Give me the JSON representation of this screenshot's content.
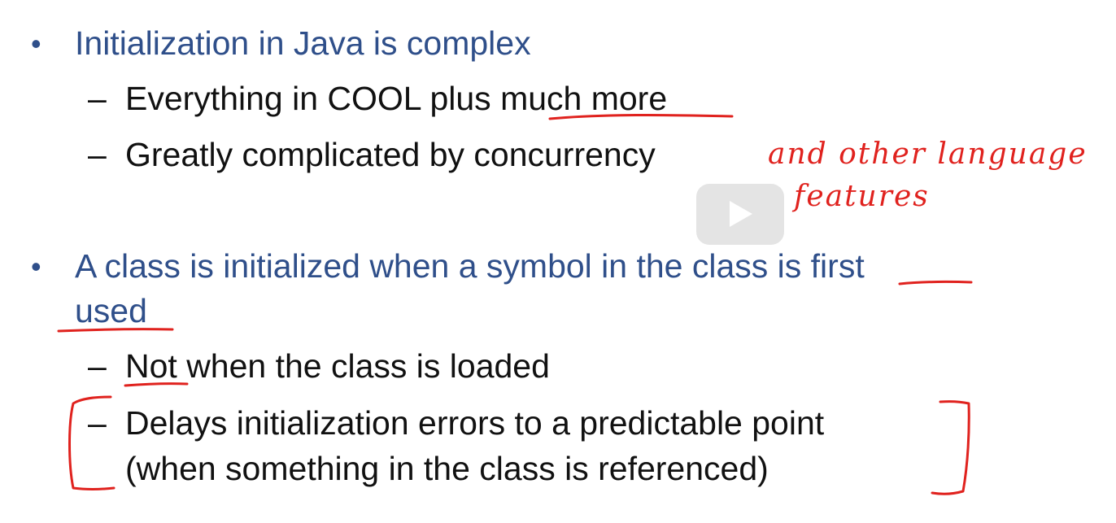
{
  "slide": {
    "bullets": [
      {
        "text": "Initialization in Java is complex",
        "sub": [
          "Everything in COOL plus much more",
          "Greatly complicated by concurrency"
        ]
      },
      {
        "text_line1": "A class is initialized when a symbol in the class is first",
        "text_line2": "used",
        "sub": [
          "Not when the class is loaded",
          "Delays initialization errors to a predictable point",
          "(when something in the class is referenced)"
        ]
      }
    ],
    "bullet_glyph": "•",
    "dash_glyph": "–"
  },
  "annotations": {
    "handwritten_line1": "and other language",
    "handwritten_line2": "features",
    "ink_color": "#e0221e"
  },
  "video_overlay": {
    "play_icon": "play-icon"
  },
  "colors": {
    "level1_text": "#2f4f8a",
    "level2_text": "#111111",
    "ink": "#e0221e"
  }
}
